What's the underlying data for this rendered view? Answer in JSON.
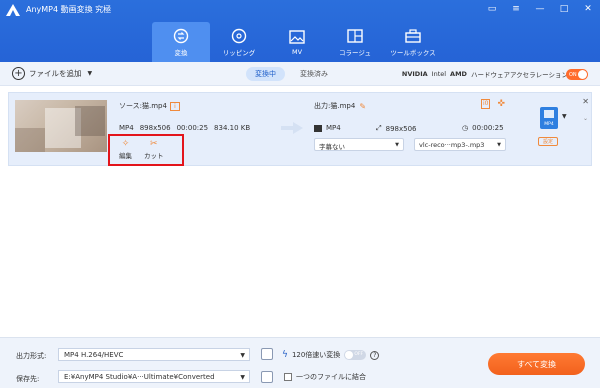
{
  "app": {
    "title": "AnyMP4 動画変換 究極"
  },
  "nav": {
    "tabs": [
      {
        "label": "変換",
        "icon": "convert-icon",
        "active": true
      },
      {
        "label": "リッピング",
        "icon": "disc-icon",
        "active": false
      },
      {
        "label": "MV",
        "icon": "image-icon",
        "active": false
      },
      {
        "label": "コラージュ",
        "icon": "collage-icon",
        "active": false
      },
      {
        "label": "ツールボックス",
        "icon": "toolbox-icon",
        "active": false
      }
    ]
  },
  "subbar": {
    "add_file": "ファイルを追加",
    "seg_converting": "変換中",
    "seg_converted": "変換済み",
    "accel_nvidia": "NVIDIA",
    "accel_intel": "Intel",
    "accel_amd": "AMD",
    "accel_label": "ハードウェアアクセラレーション",
    "accel_toggle": "ON"
  },
  "file": {
    "source_name": "ソース:猫.mp4",
    "format": "MP4",
    "resolution": "898x506",
    "duration": "00:00:25",
    "size": "834.10 KB",
    "edit_label": "編集",
    "cut_label": "カット",
    "output_name": "出力:猫.mp4",
    "out_format": "MP4",
    "out_resolution": "898x506",
    "out_duration": "00:00:25",
    "subtitle": "字幕ない",
    "audio": "vlc-reco···mp3-.mp3",
    "format_button": "MP4",
    "settings_tag": "設定"
  },
  "bottom": {
    "output_format_label": "出力形式:",
    "output_format_value": "MP4 H.264/HEVC",
    "speed_label": "120倍速い変換",
    "speed_toggle": "OFF",
    "save_label": "保存先:",
    "save_value": "E:¥AnyMP4 Studio¥A···Ultimate¥Converted",
    "merge_label": "一つのファイルに結合",
    "convert_all": "すべて変換"
  },
  "colors": {
    "primary": "#2563d6",
    "accent": "#f2611d",
    "highlight": "#e3141b"
  }
}
